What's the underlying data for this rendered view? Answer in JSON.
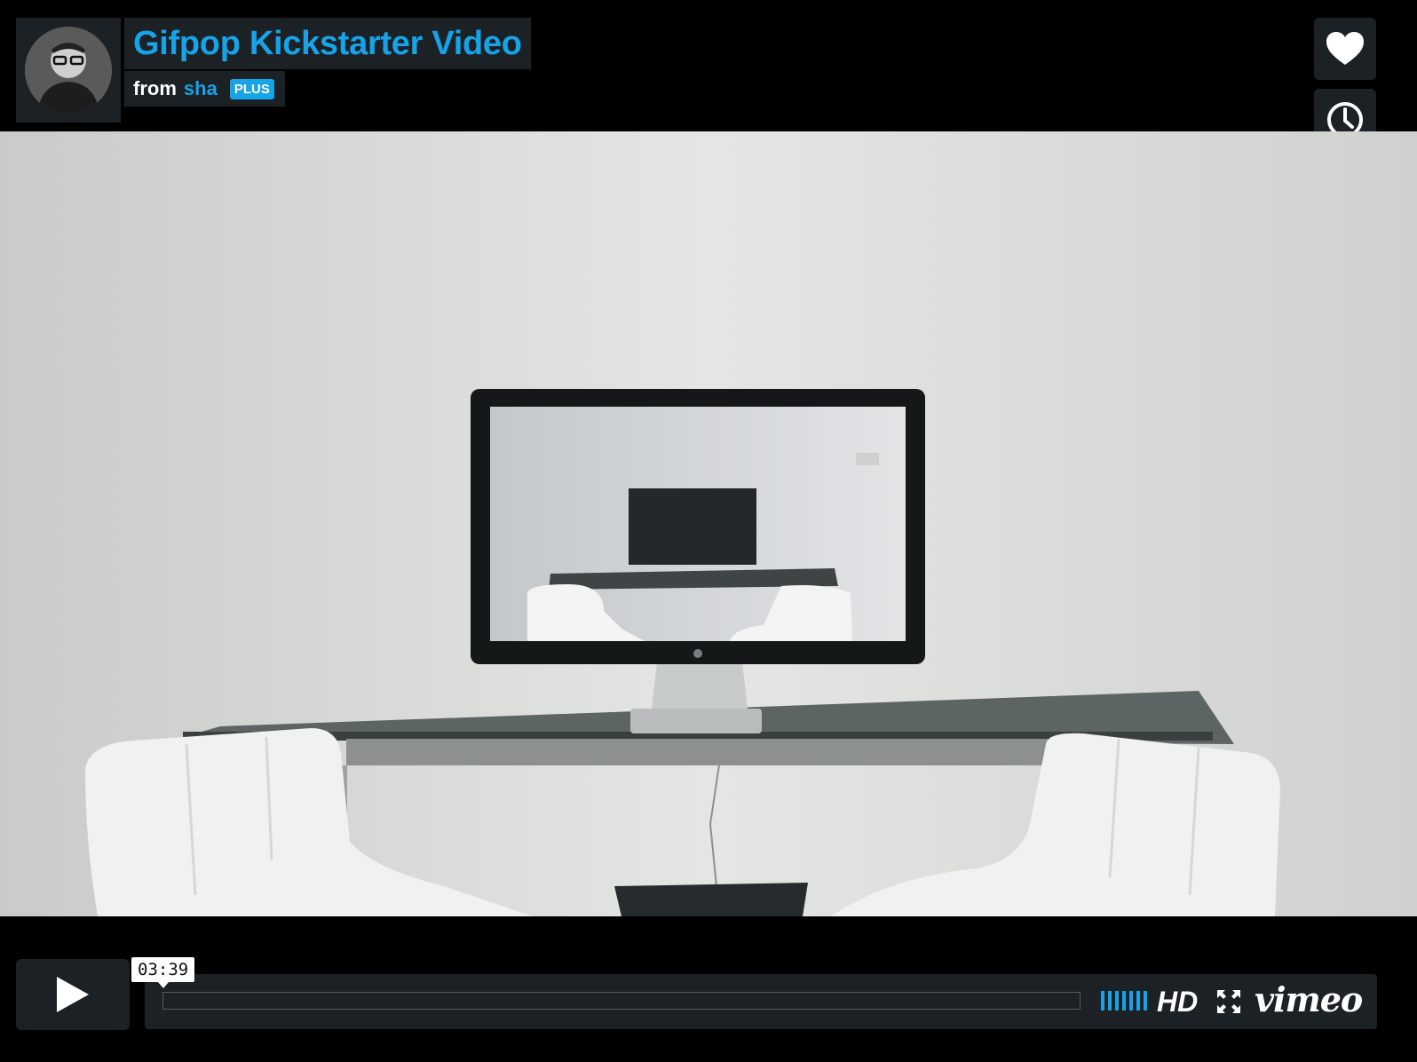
{
  "video": {
    "title": "Gifpop Kickstarter Video",
    "byline_from": "from",
    "author": "sha",
    "author_badge": "PLUS",
    "current_time": "03:39",
    "progress_fraction": 0
  },
  "controls": {
    "hd_label": "HD",
    "brand": "vimeo"
  },
  "side_actions": [
    {
      "icon": "heart-icon"
    },
    {
      "icon": "clock-icon"
    },
    {
      "icon": "paper-plane-icon"
    }
  ],
  "colors": {
    "accent": "#16a3e8",
    "panel": "#1b2125",
    "background": "#000000"
  }
}
